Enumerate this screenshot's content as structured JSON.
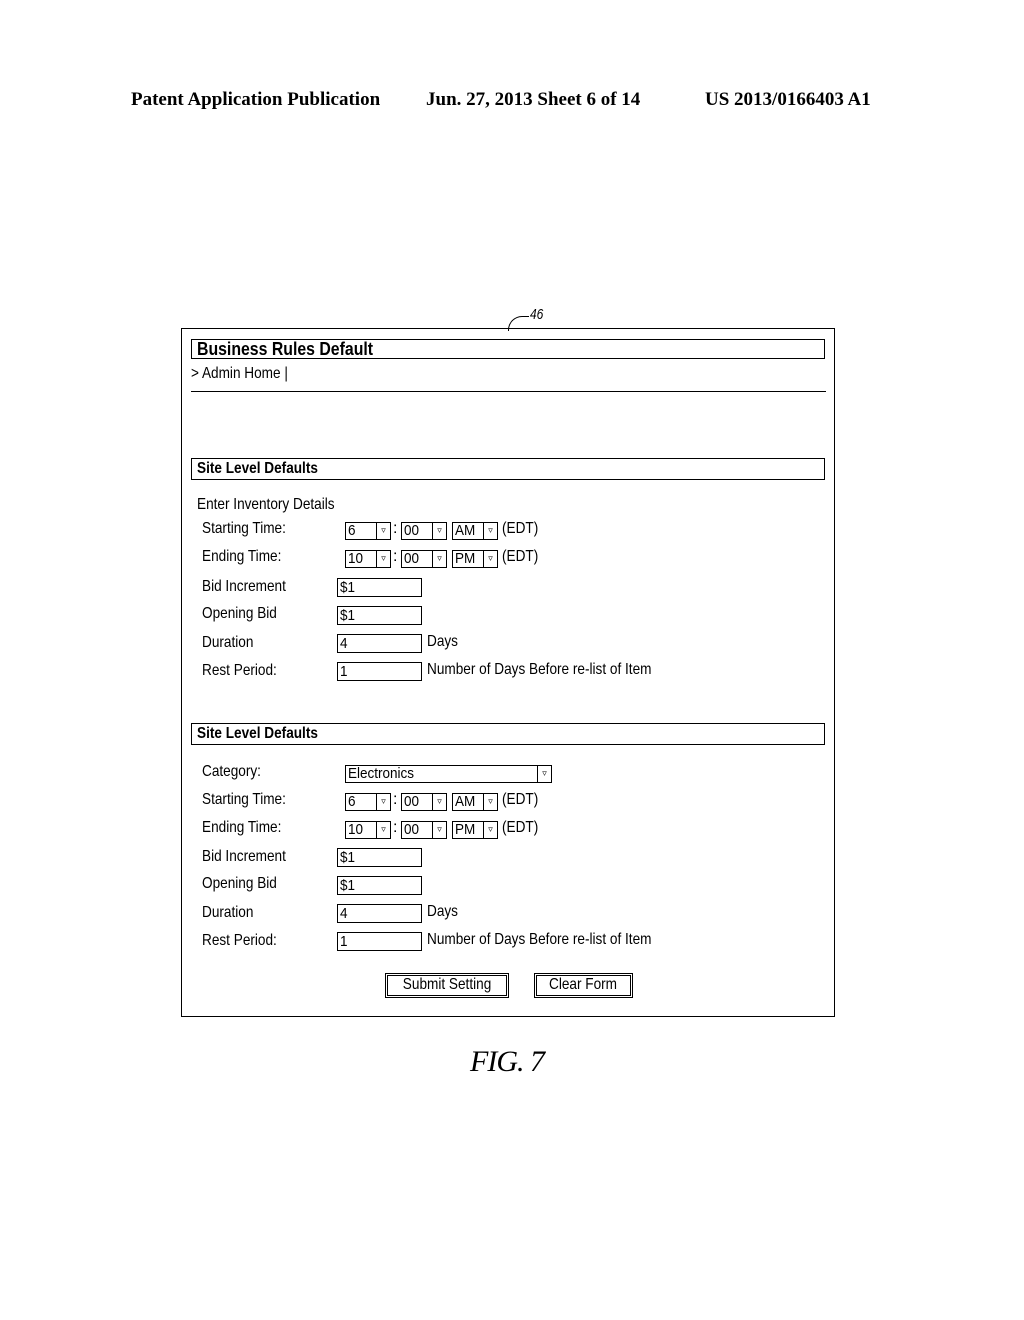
{
  "patent_header": {
    "left": "Patent Application Publication",
    "middle": "Jun. 27, 2013  Sheet 6 of 14",
    "right": "US 2013/0166403 A1"
  },
  "reference_numeral": "46",
  "window": {
    "title": "Business Rules Default",
    "breadcrumb": "> Admin Home |"
  },
  "section1": {
    "header": "Site Level Defaults",
    "subheading": "Enter Inventory Details",
    "starting_time": {
      "label": "Starting Time:",
      "hour": "6",
      "minute": "00",
      "ampm": "AM",
      "tz": "(EDT)"
    },
    "ending_time": {
      "label": "Ending Time:",
      "hour": "10",
      "minute": "00",
      "ampm": "PM",
      "tz": "(EDT)"
    },
    "bid_increment": {
      "label": "Bid Increment",
      "value": "$1"
    },
    "opening_bid": {
      "label": "Opening Bid",
      "value": "$1"
    },
    "duration": {
      "label": "Duration",
      "value": "4",
      "suffix": "Days"
    },
    "rest_period": {
      "label": "Rest Period:",
      "value": "1",
      "suffix": "Number of Days Before re-list of Item"
    }
  },
  "section2": {
    "header": "Site Level Defaults",
    "category": {
      "label": "Category:",
      "value": "Electronics"
    },
    "starting_time": {
      "label": "Starting Time:",
      "hour": "6",
      "minute": "00",
      "ampm": "AM",
      "tz": "(EDT)"
    },
    "ending_time": {
      "label": "Ending Time:",
      "hour": "10",
      "minute": "00",
      "ampm": "PM",
      "tz": "(EDT)"
    },
    "bid_increment": {
      "label": "Bid Increment",
      "value": "$1"
    },
    "opening_bid": {
      "label": "Opening Bid",
      "value": "$1"
    },
    "duration": {
      "label": "Duration",
      "value": "4",
      "suffix": "Days"
    },
    "rest_period": {
      "label": "Rest Period:",
      "value": "1",
      "suffix": "Number of Days Before re-list of Item"
    }
  },
  "buttons": {
    "submit": "Submit Setting",
    "clear": "Clear Form"
  },
  "icons": {
    "dropdown_arrow": "▿"
  },
  "figure_label": "FIG. 7"
}
